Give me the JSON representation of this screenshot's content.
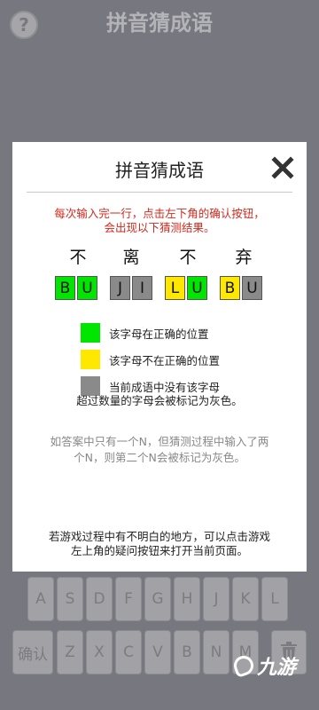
{
  "background": {
    "title": "拼音猜成语",
    "help_button": "?",
    "keyboard": {
      "row1": [
        "A",
        "S",
        "D",
        "F",
        "G",
        "H",
        "J",
        "K",
        "L"
      ],
      "confirm": "确认",
      "row2": [
        "Z",
        "X",
        "C",
        "V",
        "B",
        "N",
        "M"
      ],
      "delete_icon": "trash-icon"
    },
    "watermark": "九游"
  },
  "modal": {
    "title": "拼音猜成语",
    "close_icon": "close-icon",
    "instruction_line1": "每次输入完一行，点击左下角的确认按钮，",
    "instruction_line2": "会出现以下猜测结果。",
    "idiom_chars": [
      "不",
      "离",
      "不",
      "弃"
    ],
    "tiles": [
      {
        "letter": "B",
        "state": "correct"
      },
      {
        "letter": "U",
        "state": "correct"
      },
      {
        "letter": "J",
        "state": "absent"
      },
      {
        "letter": "I",
        "state": "absent"
      },
      {
        "letter": "L",
        "state": "misplaced"
      },
      {
        "letter": "U",
        "state": "correct"
      },
      {
        "letter": "B",
        "state": "misplaced"
      },
      {
        "letter": "U",
        "state": "absent"
      }
    ],
    "legend": [
      {
        "color": "#00e600",
        "label": "该字母在正确的位置"
      },
      {
        "color": "#ffe800",
        "label": "该字母不在正确的位置"
      },
      {
        "color": "#8a8a8a",
        "label": "当前成语中没有该字母"
      }
    ],
    "rule_excess": "超过数量的字母会被标记为灰色。",
    "rule_example_line1": "如答案中只有一个N，但猜测过程中输入了两",
    "rule_example_line2": "个N，则第二个N会被标记为灰色。",
    "help_note_line1": "若游戏过程中有不明白的地方，可以点击游戏",
    "help_note_line2": "左上角的疑问按钮来打开当前页面。"
  },
  "colors": {
    "correct": "#00e600",
    "misplaced": "#ffe800",
    "absent": "#8a8a8a",
    "instruction_red": "#d22a1e"
  }
}
